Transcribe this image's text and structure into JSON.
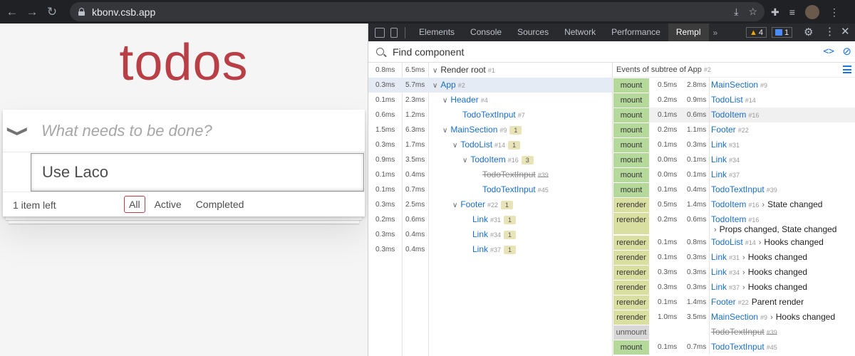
{
  "browser": {
    "url": "kbonv.csb.app",
    "back_icon": "←",
    "forward_icon": "→",
    "reload_icon": "↻"
  },
  "app": {
    "title": "todos",
    "new_todo_placeholder": "What needs to be done?",
    "toggle_all_icon": "❯",
    "editing_value": "Use Laco",
    "items_left": "1 item left",
    "filters": [
      {
        "label": "All",
        "selected": true
      },
      {
        "label": "Active",
        "selected": false
      },
      {
        "label": "Completed",
        "selected": false
      }
    ],
    "accent": "#b83f45"
  },
  "devtools": {
    "tabs": [
      "Elements",
      "Console",
      "Sources",
      "Network",
      "Performance",
      "Rempl"
    ],
    "active_tab": "Rempl",
    "more_tabs": "»",
    "warnings_count": "4",
    "messages_count": "1",
    "search_placeholder": "Find component",
    "tree": [
      {
        "t1": "0.8ms",
        "t2": "6.5ms",
        "depth": 0,
        "arrow": "∨",
        "name": "Render root",
        "id": "#1",
        "kind": "root",
        "badge": ""
      },
      {
        "t1": "0.3ms",
        "t2": "5.7ms",
        "depth": 0,
        "arrow": "∨",
        "name": "App",
        "id": "#2",
        "kind": "normal",
        "badge": "",
        "selected": true
      },
      {
        "t1": "0.1ms",
        "t2": "2.3ms",
        "depth": 1,
        "arrow": "∨",
        "name": "Header",
        "id": "#4",
        "kind": "normal",
        "badge": ""
      },
      {
        "t1": "0.6ms",
        "t2": "1.2ms",
        "depth": 2,
        "arrow": "",
        "name": "TodoTextInput",
        "id": "#7",
        "kind": "normal",
        "badge": ""
      },
      {
        "t1": "1.5ms",
        "t2": "6.3ms",
        "depth": 1,
        "arrow": "∨",
        "name": "MainSection",
        "id": "#9",
        "kind": "normal",
        "badge": "1"
      },
      {
        "t1": "0.3ms",
        "t2": "1.7ms",
        "depth": 2,
        "arrow": "∨",
        "name": "TodoList",
        "id": "#14",
        "kind": "normal",
        "badge": "1"
      },
      {
        "t1": "0.9ms",
        "t2": "3.5ms",
        "depth": 3,
        "arrow": "∨",
        "name": "TodoItem",
        "id": "#16",
        "kind": "normal",
        "badge": "3"
      },
      {
        "t1": "0.1ms",
        "t2": "0.4ms",
        "depth": 4,
        "arrow": "",
        "name": "TodoTextInput",
        "id": "#39",
        "kind": "strike",
        "badge": ""
      },
      {
        "t1": "0.1ms",
        "t2": "0.7ms",
        "depth": 4,
        "arrow": "",
        "name": "TodoTextInput",
        "id": "#45",
        "kind": "normal",
        "badge": ""
      },
      {
        "t1": "0.3ms",
        "t2": "2.5ms",
        "depth": 2,
        "arrow": "∨",
        "name": "Footer",
        "id": "#22",
        "kind": "normal",
        "badge": "1"
      },
      {
        "t1": "0.2ms",
        "t2": "0.6ms",
        "depth": 3,
        "arrow": "",
        "name": "Link",
        "id": "#31",
        "kind": "normal",
        "badge": "1"
      },
      {
        "t1": "0.3ms",
        "t2": "0.4ms",
        "depth": 3,
        "arrow": "",
        "name": "Link",
        "id": "#34",
        "kind": "normal",
        "badge": "1"
      },
      {
        "t1": "0.3ms",
        "t2": "0.4ms",
        "depth": 3,
        "arrow": "",
        "name": "Link",
        "id": "#37",
        "kind": "normal",
        "badge": "1"
      }
    ],
    "events_header": "Events of subtree of App",
    "events_header_id": "#2",
    "events": [
      {
        "type": "mount",
        "t1": "0.5ms",
        "t2": "2.8ms",
        "name": "MainSection",
        "id": "#9",
        "detail": "",
        "sub": ""
      },
      {
        "type": "mount",
        "t1": "0.2ms",
        "t2": "0.9ms",
        "name": "TodoList",
        "id": "#14",
        "detail": "",
        "sub": ""
      },
      {
        "type": "mount",
        "t1": "0.1ms",
        "t2": "0.6ms",
        "name": "TodoItem",
        "id": "#16",
        "detail": "",
        "sub": "",
        "highlight": true
      },
      {
        "type": "mount",
        "t1": "0.2ms",
        "t2": "1.1ms",
        "name": "Footer",
        "id": "#22",
        "detail": "",
        "sub": ""
      },
      {
        "type": "mount",
        "t1": "0.1ms",
        "t2": "0.3ms",
        "name": "Link",
        "id": "#31",
        "detail": "",
        "sub": ""
      },
      {
        "type": "mount",
        "t1": "0.0ms",
        "t2": "0.1ms",
        "name": "Link",
        "id": "#34",
        "detail": "",
        "sub": ""
      },
      {
        "type": "mount",
        "t1": "0.0ms",
        "t2": "0.1ms",
        "name": "Link",
        "id": "#37",
        "detail": "",
        "sub": ""
      },
      {
        "type": "mount",
        "t1": "0.1ms",
        "t2": "0.4ms",
        "name": "TodoTextInput",
        "id": "#39",
        "detail": "",
        "sub": ""
      },
      {
        "type": "rerender",
        "t1": "0.5ms",
        "t2": "1.4ms",
        "name": "TodoItem",
        "id": "#16",
        "detail": "State changed",
        "arrow": true,
        "sub": ""
      },
      {
        "type": "rerender",
        "t1": "0.2ms",
        "t2": "0.6ms",
        "name": "TodoItem",
        "id": "#16",
        "detail": "",
        "sub": "Props changed, State changed"
      },
      {
        "type": "rerender",
        "t1": "0.1ms",
        "t2": "0.8ms",
        "name": "TodoList",
        "id": "#14",
        "detail": "Hooks changed",
        "arrow": true,
        "sub": ""
      },
      {
        "type": "rerender",
        "t1": "0.1ms",
        "t2": "0.3ms",
        "name": "Link",
        "id": "#31",
        "detail": "Hooks changed",
        "arrow": true,
        "sub": ""
      },
      {
        "type": "rerender",
        "t1": "0.3ms",
        "t2": "0.3ms",
        "name": "Link",
        "id": "#34",
        "detail": "Hooks changed",
        "arrow": true,
        "sub": ""
      },
      {
        "type": "rerender",
        "t1": "0.3ms",
        "t2": "0.3ms",
        "name": "Link",
        "id": "#37",
        "detail": "Hooks changed",
        "arrow": true,
        "sub": ""
      },
      {
        "type": "rerender",
        "t1": "0.1ms",
        "t2": "1.4ms",
        "name": "Footer",
        "id": "#22",
        "detail": "Parent render",
        "arrow": false,
        "sub": ""
      },
      {
        "type": "rerender",
        "t1": "1.0ms",
        "t2": "3.5ms",
        "name": "MainSection",
        "id": "#9",
        "detail": "Hooks changed",
        "arrow": true,
        "sub": ""
      },
      {
        "type": "unmount",
        "t1": "",
        "t2": "",
        "name": "TodoTextInput",
        "id": "#39",
        "detail": "",
        "sub": "",
        "strike": true
      },
      {
        "type": "mount",
        "t1": "0.1ms",
        "t2": "0.7ms",
        "name": "TodoTextInput",
        "id": "#45",
        "detail": "",
        "sub": ""
      }
    ]
  }
}
